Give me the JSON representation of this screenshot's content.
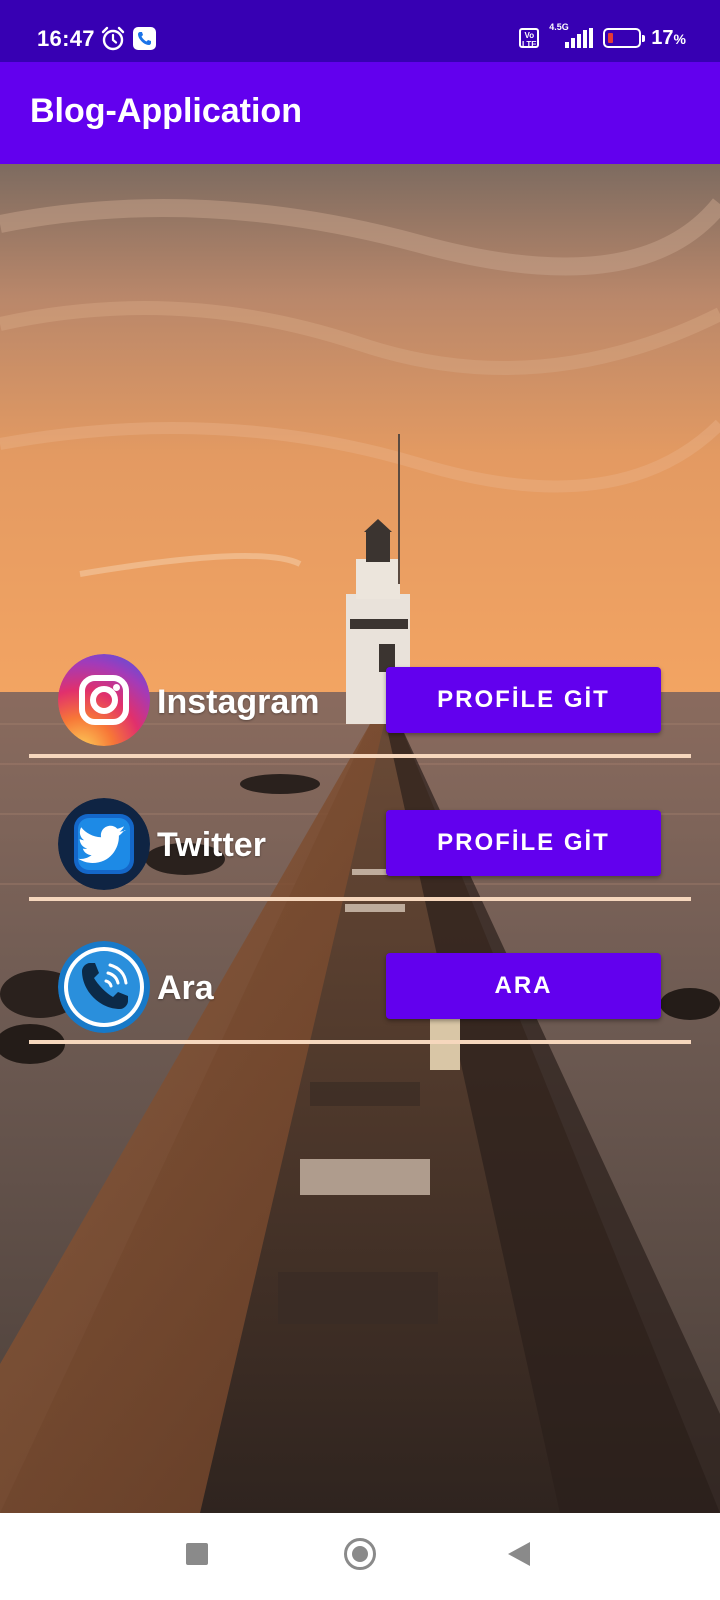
{
  "status_bar": {
    "time": "16:47",
    "network_badge": "Vo LTE",
    "network_type": "4.5G",
    "battery_percent": "17",
    "battery_unit": "%",
    "battery_level": 0.17,
    "battery_color": "#e53935"
  },
  "app_bar": {
    "title": "Blog-Application",
    "color": "#6200ee"
  },
  "rows": [
    {
      "icon": "instagram-icon",
      "label": "Instagram",
      "button_label": "PROFİLE GİT"
    },
    {
      "icon": "twitter-icon",
      "label": "Twitter",
      "button_label": "PROFİLE GİT"
    },
    {
      "icon": "phone-call-icon",
      "label": "Ara",
      "button_label": "ARA"
    }
  ],
  "background": {
    "image": "lighthouse-pier-sunset"
  },
  "nav_bar": {
    "recents_icon": "square-recents-icon",
    "home_icon": "circle-home-icon",
    "back_icon": "triangle-back-icon"
  }
}
